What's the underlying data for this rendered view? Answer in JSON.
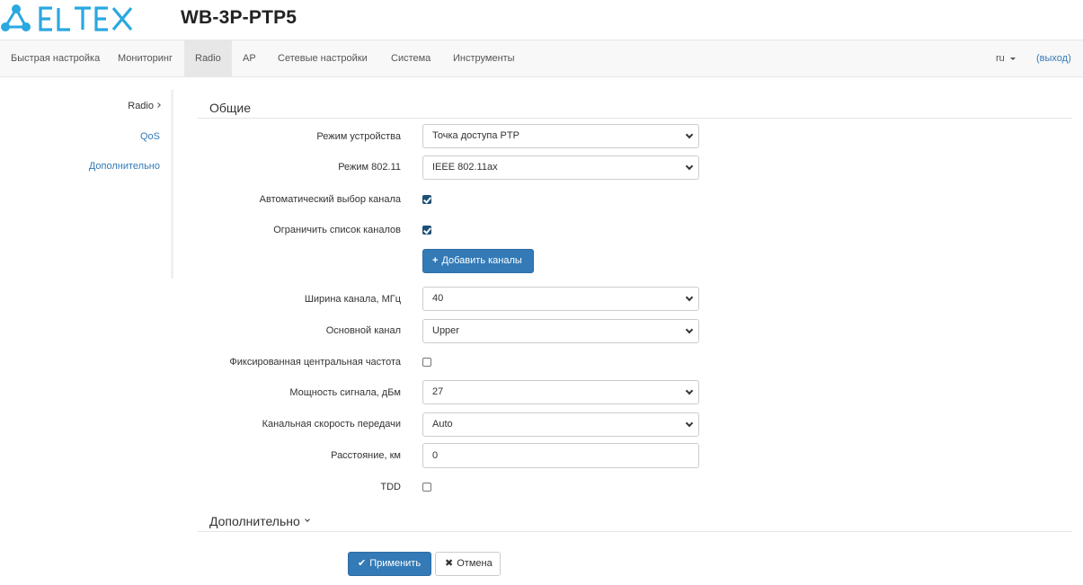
{
  "header": {
    "brand": "ELTEX",
    "device_title": "WB-3P-PTP5"
  },
  "navbar": {
    "items": [
      {
        "label": "Быстрая настройка"
      },
      {
        "label": "Мониторинг"
      },
      {
        "label": "Radio",
        "active": true
      },
      {
        "label": "AP"
      },
      {
        "label": "Сетевые настройки"
      },
      {
        "label": "Система"
      },
      {
        "label": "Инструменты"
      }
    ],
    "language": "ru",
    "logout": "(выход)"
  },
  "sidebar": {
    "items": [
      {
        "label": "Radio",
        "active": true
      },
      {
        "label": "QoS"
      },
      {
        "label": "Дополнительно"
      }
    ]
  },
  "general": {
    "title": "Общие",
    "device_mode": {
      "label": "Режим устройства",
      "value": "Точка доступа PTP"
    },
    "mode_80211": {
      "label": "Режим 802.11",
      "value": "IEEE 802.11ax"
    },
    "auto_channel": {
      "label": "Автоматический выбор канала",
      "checked": true
    },
    "limit_channels": {
      "label": "Ограничить список каналов",
      "checked": true
    },
    "add_channels_button": "Добавить каналы",
    "channel_width": {
      "label": "Ширина канала, МГц",
      "value": "40"
    },
    "primary_channel": {
      "label": "Основной канал",
      "value": "Upper"
    },
    "fixed_center_freq": {
      "label": "Фиксированная центральная частота",
      "checked": false
    },
    "signal_power": {
      "label": "Мощность сигнала, дБм",
      "value": "27"
    },
    "channel_rate": {
      "label": "Канальная скорость передачи",
      "value": "Auto"
    },
    "distance": {
      "label": "Расстояние, км",
      "value": "0"
    },
    "tdd": {
      "label": "TDD",
      "checked": false
    }
  },
  "advanced": {
    "title": "Дополнительно"
  },
  "actions": {
    "apply": "Применить",
    "cancel": "Отмена"
  },
  "colors": {
    "brand": "#2aa8e0",
    "primary": "#337ab7",
    "checkbox_checked": "#1e4f74"
  },
  "icons": {
    "add": "plus-icon",
    "apply": "check-icon",
    "cancel": "x-icon"
  }
}
